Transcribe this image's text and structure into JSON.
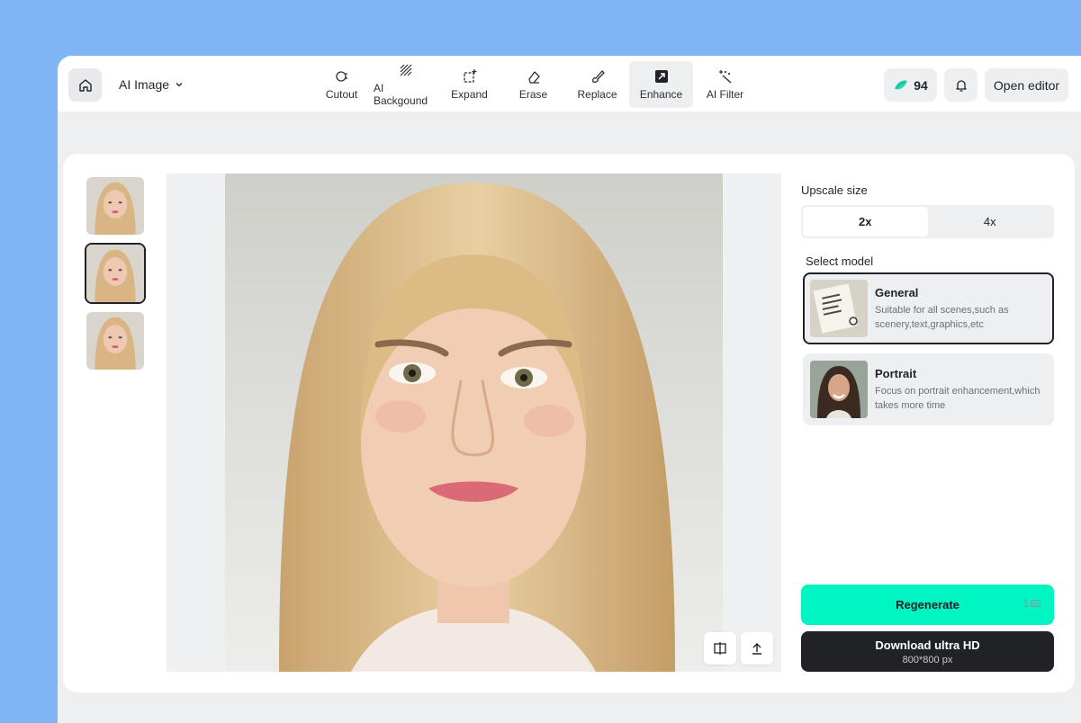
{
  "header": {
    "app_menu_label": "AI Image",
    "tools": [
      {
        "label": "Cutout",
        "icon": "cutout-icon"
      },
      {
        "label": "AI Backgound",
        "icon": "ai-background-icon"
      },
      {
        "label": "Expand",
        "icon": "expand-icon"
      },
      {
        "label": "Erase",
        "icon": "eraser-icon"
      },
      {
        "label": "Replace",
        "icon": "replace-brush-icon"
      },
      {
        "label": "Enhance",
        "icon": "enhance-icon",
        "active": true
      },
      {
        "label": "AI Filter",
        "icon": "magic-wand-icon"
      }
    ],
    "credits": "94",
    "open_editor_label": "Open editor"
  },
  "thumbnails": {
    "count": 3,
    "selected_index": 1
  },
  "settings": {
    "upscale_label": "Upscale size",
    "upscale_options": [
      "2x",
      "4x"
    ],
    "upscale_selected": "2x",
    "model_label": "Select model",
    "models": [
      {
        "title": "General",
        "desc": "Suitable for all scenes,such as scenery,text,graphics,etc",
        "selected": true
      },
      {
        "title": "Portrait",
        "desc": "Focus on portrait enhancement,which takes more time",
        "selected": false
      }
    ],
    "regenerate_label": "Regenerate",
    "regenerate_cost": "1",
    "download_label": "Download ultra HD",
    "download_size": "800*800 px"
  },
  "colors": {
    "accent": "#00f5c3",
    "dark_button": "#202226",
    "page_bg": "#7fb5f2"
  }
}
